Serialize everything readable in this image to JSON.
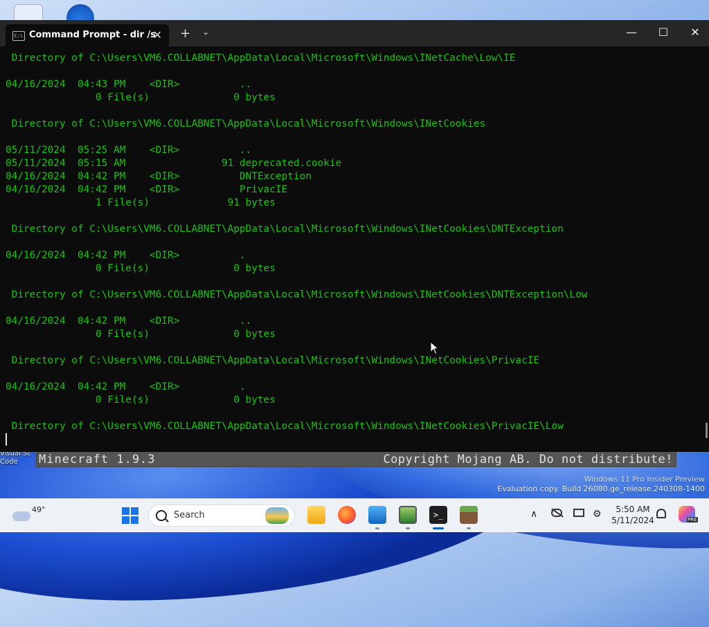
{
  "desktop": {
    "icon_label": "Visual St Code",
    "watermark": {
      "line1": "Windows 11 Pro Insider Preview",
      "line2": "Evaluation copy. Build 26080.ge_release.240308-1400"
    }
  },
  "minecraft_bar": {
    "version": "Minecraft 1.9.3",
    "copyright": "Copyright Mojang AB. Do not distribute!"
  },
  "window": {
    "tab_title": "Command Prompt - dir  /s",
    "tab_icon_text": "C:\\",
    "tab_close": "✕",
    "new_tab": "+",
    "dropdown": "⌄",
    "minimize": "—",
    "maximize": "☐",
    "close": "✕"
  },
  "terminal": {
    "lines": [
      " Directory of C:\\Users\\VM6.COLLABNET\\AppData\\Local\\Microsoft\\Windows\\INetCache\\Low\\IE",
      "",
      "04/16/2024  04:43 PM    <DIR>          ..",
      "               0 File(s)              0 bytes",
      "",
      " Directory of C:\\Users\\VM6.COLLABNET\\AppData\\Local\\Microsoft\\Windows\\INetCookies",
      "",
      "05/11/2024  05:25 AM    <DIR>          ..",
      "05/11/2024  05:15 AM                91 deprecated.cookie",
      "04/16/2024  04:42 PM    <DIR>          DNTException",
      "04/16/2024  04:42 PM    <DIR>          PrivacIE",
      "               1 File(s)             91 bytes",
      "",
      " Directory of C:\\Users\\VM6.COLLABNET\\AppData\\Local\\Microsoft\\Windows\\INetCookies\\DNTException",
      "",
      "04/16/2024  04:42 PM    <DIR>          .",
      "               0 File(s)              0 bytes",
      "",
      " Directory of C:\\Users\\VM6.COLLABNET\\AppData\\Local\\Microsoft\\Windows\\INetCookies\\DNTException\\Low",
      "",
      "04/16/2024  04:42 PM    <DIR>          ..",
      "               0 File(s)              0 bytes",
      "",
      " Directory of C:\\Users\\VM6.COLLABNET\\AppData\\Local\\Microsoft\\Windows\\INetCookies\\PrivacIE",
      "",
      "04/16/2024  04:42 PM    <DIR>          .",
      "               0 File(s)              0 bytes",
      "",
      " Directory of C:\\Users\\VM6.COLLABNET\\AppData\\Local\\Microsoft\\Windows\\INetCookies\\PrivacIE\\Low"
    ],
    "text_color": "#16c60c",
    "background": "#0c0c0c"
  },
  "taskbar": {
    "weather_temp": "49°",
    "search_label": "Search",
    "terminal_glyph": ">_",
    "tray_up": "∧",
    "tray_net": "⚙",
    "clock_time": "5:50 AM",
    "clock_date": "5/11/2024",
    "copilot_badge": "PRE",
    "icons": [
      "start-icon",
      "search-icon",
      "file-explorer-icon",
      "firefox-icon",
      "photos-icon",
      "task-manager-icon",
      "terminal-icon",
      "minecraft-icon",
      "chevron-up-icon",
      "onedrive-off-icon",
      "monitor-icon",
      "network-icon",
      "bell-icon",
      "copilot-icon"
    ]
  }
}
